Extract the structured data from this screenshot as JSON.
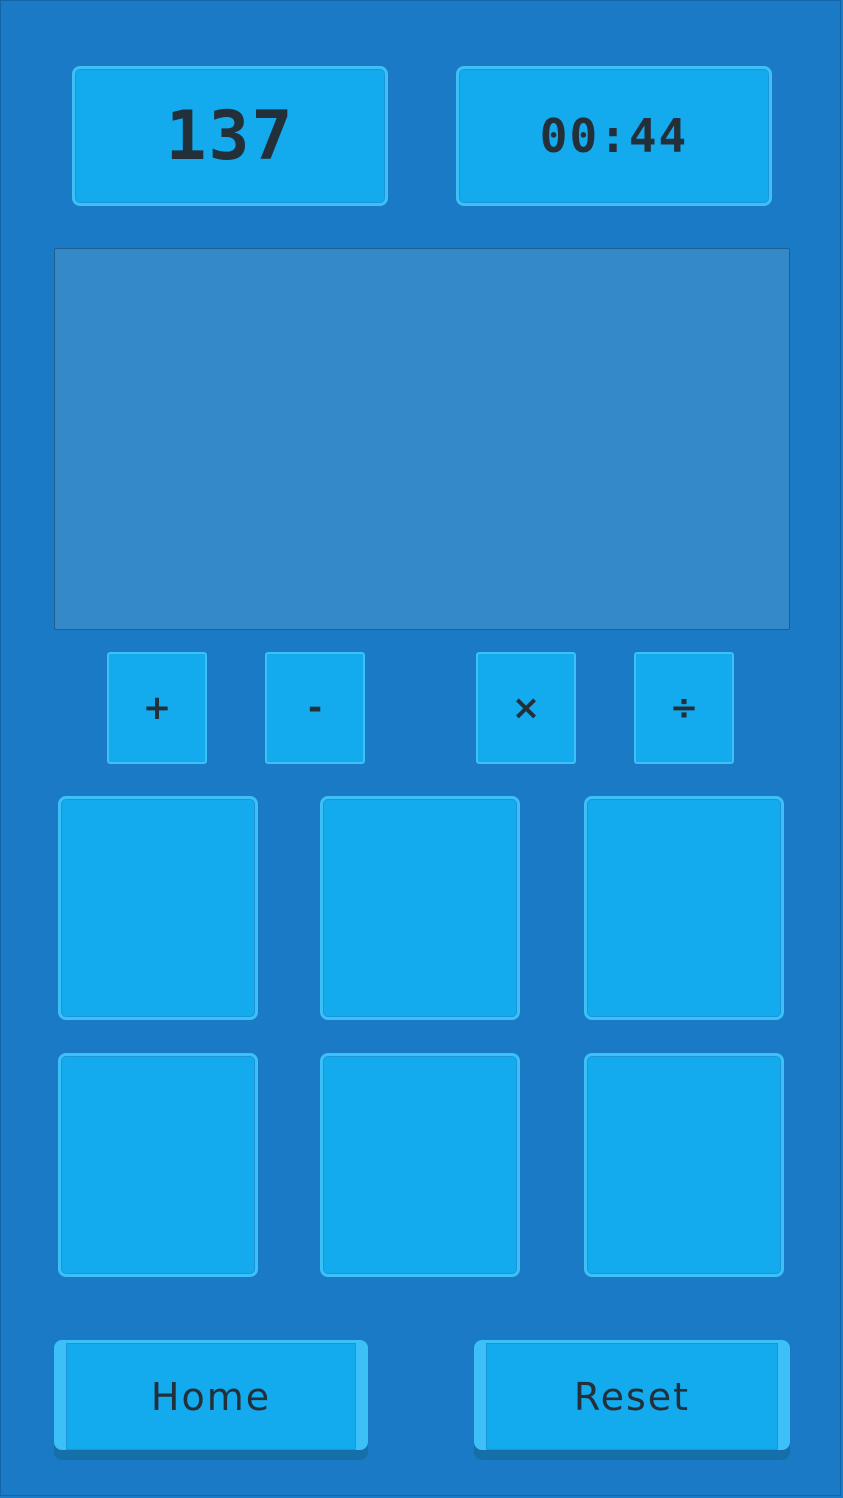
{
  "hud": {
    "target": "137",
    "timer": "00:44"
  },
  "operators": [
    {
      "symbol": "+",
      "name": "plus"
    },
    {
      "symbol": "-",
      "name": "minus"
    },
    {
      "symbol": "×",
      "name": "multiply"
    },
    {
      "symbol": "÷",
      "name": "divide"
    }
  ],
  "number_tiles": [
    "",
    "",
    "",
    "",
    "",
    ""
  ],
  "buttons": {
    "home": "Home",
    "reset": "Reset"
  },
  "colors": {
    "background": "#1a7ac6",
    "tile": "#13aaee",
    "tile_border": "#3cc0f7",
    "work_area": "#3489c8",
    "text": "#23303a"
  }
}
